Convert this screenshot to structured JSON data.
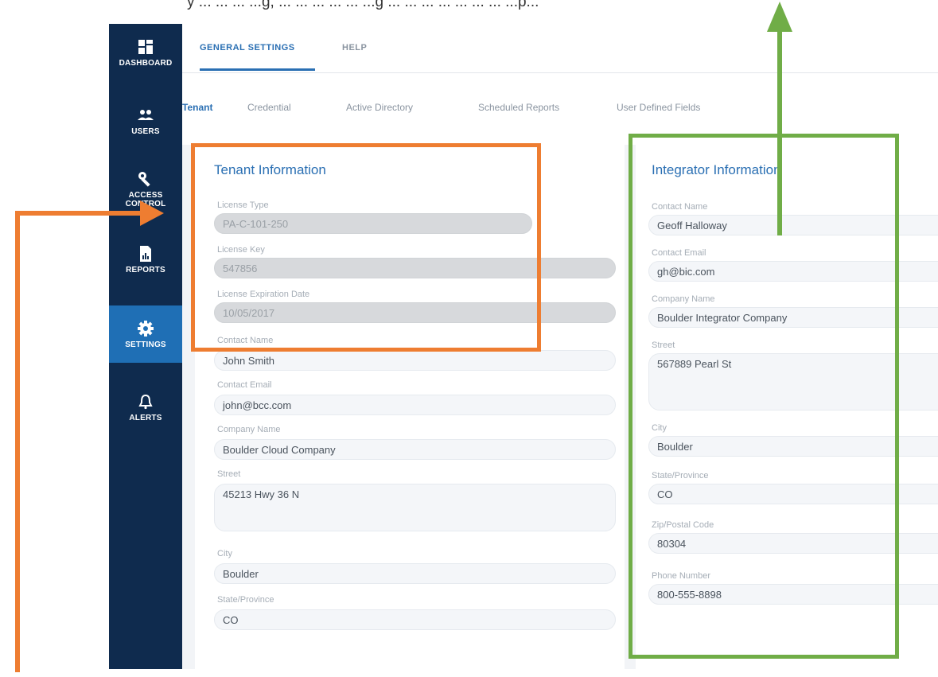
{
  "intro_text": "y ... ... ... ...g, ... ... ... ... ... ...g ... ... ... ... ... ... ... ...p...",
  "sidebar": {
    "items": [
      {
        "label": "DASHBOARD",
        "icon": "dashboard-grid-icon"
      },
      {
        "label": "USERS",
        "icon": "users-icon"
      },
      {
        "label": "ACCESS CONTROL",
        "icon": "key-icon"
      },
      {
        "label": "REPORTS",
        "icon": "report-file-icon"
      },
      {
        "label": "SETTINGS",
        "icon": "gear-icon"
      },
      {
        "label": "ALERTS",
        "icon": "bell-icon"
      }
    ],
    "active_index": 4
  },
  "tabs": [
    {
      "label": "GENERAL SETTINGS"
    },
    {
      "label": "HELP"
    }
  ],
  "subtabs": [
    {
      "label": "Tenant"
    },
    {
      "label": "Credential"
    },
    {
      "label": "Active Directory"
    },
    {
      "label": "Scheduled Reports"
    },
    {
      "label": "User Defined Fields"
    }
  ],
  "tenant": {
    "title": "Tenant Information",
    "license_type_label": "License Type",
    "license_type_value": "PA-C-101-250",
    "license_key_label": "License Key",
    "license_key_value": "547856",
    "license_exp_label": "License Expiration Date",
    "license_exp_value": "10/05/2017",
    "contact_name_label": "Contact Name",
    "contact_name_value": "John Smith",
    "contact_email_label": "Contact Email",
    "contact_email_value": "john@bcc.com",
    "company_label": "Company Name",
    "company_value": "Boulder Cloud Company",
    "street_label": "Street",
    "street_value": "45213 Hwy 36 N",
    "city_label": "City",
    "city_value": "Boulder",
    "state_label": "State/Province",
    "state_value": "CO"
  },
  "integrator": {
    "title": "Integrator Information",
    "contact_name_label": "Contact Name",
    "contact_name_value": "Geoff Halloway",
    "contact_email_label": "Contact Email",
    "contact_email_value": "gh@bic.com",
    "company_label": "Company Name",
    "company_value": "Boulder Integrator Company",
    "street_label": "Street",
    "street_value": "567889 Pearl St",
    "city_label": "City",
    "city_value": "Boulder",
    "state_label": "State/Province",
    "state_value": "CO",
    "zip_label": "Zip/Postal Code",
    "zip_value": "80304",
    "phone_label": "Phone Number",
    "phone_value": "800-555-8898"
  },
  "colors": {
    "sidebar_bg": "#0f2b4e",
    "sidebar_active": "#1f6fb5",
    "accent": "#2a6fb3",
    "annotation_orange": "#ee7d31",
    "annotation_green": "#70ad47"
  }
}
